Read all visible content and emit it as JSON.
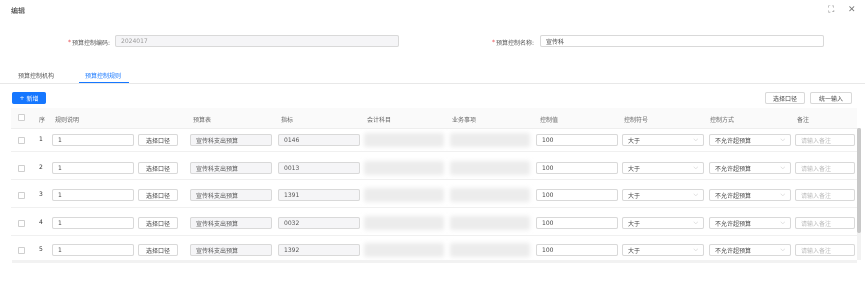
{
  "dialog": {
    "title": "编辑",
    "fullscreen_icon": "expand-icon",
    "close_icon": "close-icon"
  },
  "form": {
    "code_label": "预算控制编码:",
    "code_value": "2024017",
    "name_label": "预算控制名称:",
    "name_value": "宣传科",
    "required_mark": "*"
  },
  "tabs": [
    {
      "label": "预算控制机构"
    },
    {
      "label": "预算控制规则",
      "active": true
    }
  ],
  "toolbar": {
    "add_label": "新增",
    "add_icon": "plus-icon",
    "select_scope_label": "选择口径",
    "unified_input_label": "统一输入"
  },
  "table": {
    "headers": [
      "序",
      "规则说明",
      "预算表",
      "指标",
      "会计科目",
      "业务事项",
      "控制值",
      "控制符号",
      "控制方式",
      "备注"
    ],
    "rows": [
      {
        "no": "1",
        "rule": "1",
        "scope_btn": "选择口径",
        "budget": "宣传科支出预算",
        "indicator": "0146",
        "value": "100",
        "symbol": "大于",
        "mode": "不允许超预算",
        "remark_placeholder": "请输入备注"
      },
      {
        "no": "2",
        "rule": "1",
        "scope_btn": "选择口径",
        "budget": "宣传科支出预算",
        "indicator": "0013",
        "value": "100",
        "symbol": "大于",
        "mode": "不允许超预算",
        "remark_placeholder": "请输入备注"
      },
      {
        "no": "3",
        "rule": "1",
        "scope_btn": "选择口径",
        "budget": "宣传科支出预算",
        "indicator": "1391",
        "value": "100",
        "symbol": "大于",
        "mode": "不允许超预算",
        "remark_placeholder": "请输入备注"
      },
      {
        "no": "4",
        "rule": "1",
        "scope_btn": "选择口径",
        "budget": "宣传科支出预算",
        "indicator": "0032",
        "value": "100",
        "symbol": "大于",
        "mode": "不允许超预算",
        "remark_placeholder": "请输入备注"
      },
      {
        "no": "5",
        "rule": "1",
        "scope_btn": "选择口径",
        "budget": "宣传科支出预算",
        "indicator": "1392",
        "value": "100",
        "symbol": "大于",
        "mode": "不允许超预算",
        "remark_placeholder": "请输入备注"
      }
    ]
  },
  "colors": {
    "primary": "#1677ff",
    "required": "#e5484d",
    "border": "#d9d9d9"
  }
}
